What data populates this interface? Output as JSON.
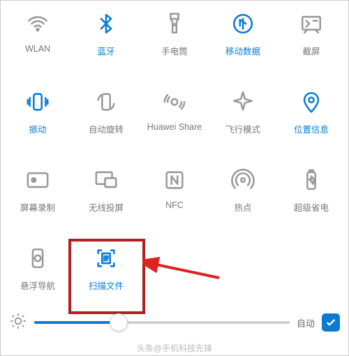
{
  "tiles": [
    {
      "id": "wlan",
      "icon": "wifi",
      "label": "WLAN",
      "active": false
    },
    {
      "id": "bluetooth",
      "icon": "bluetooth",
      "label": "蓝牙",
      "active": true
    },
    {
      "id": "flashlight",
      "icon": "flashlight",
      "label": "手电筒",
      "active": false
    },
    {
      "id": "mobile-data",
      "icon": "mobile-data",
      "label": "移动数据",
      "active": true
    },
    {
      "id": "screenshot",
      "icon": "screenshot",
      "label": "截屏",
      "active": false
    },
    {
      "id": "vibrate",
      "icon": "vibrate",
      "label": "振动",
      "active": true
    },
    {
      "id": "auto-rotate",
      "icon": "rotate",
      "label": "自动旋转",
      "active": false
    },
    {
      "id": "huawei-share",
      "icon": "share",
      "label": "Huawei Share",
      "active": false
    },
    {
      "id": "airplane",
      "icon": "airplane",
      "label": "飞行模式",
      "active": false
    },
    {
      "id": "location",
      "icon": "location",
      "label": "位置信息",
      "active": true
    },
    {
      "id": "screen-rec",
      "icon": "screen-rec",
      "label": "屏幕录制",
      "active": false
    },
    {
      "id": "cast",
      "icon": "cast",
      "label": "无线投屏",
      "active": false
    },
    {
      "id": "nfc",
      "icon": "nfc",
      "label": "NFC",
      "active": false
    },
    {
      "id": "hotspot",
      "icon": "hotspot",
      "label": "热点",
      "active": false
    },
    {
      "id": "power-save",
      "icon": "battery",
      "label": "超级省电",
      "active": false
    },
    {
      "id": "float-nav",
      "icon": "float-nav",
      "label": "悬浮导航",
      "active": false
    },
    {
      "id": "scan-doc",
      "icon": "scan-doc",
      "label": "扫描文件",
      "active": true
    }
  ],
  "brightness": {
    "auto_label": "自动",
    "auto_checked": true,
    "value_percent": 33
  },
  "highlight": {
    "target": "scan-doc"
  },
  "watermark": "头条@手机科技先锋"
}
